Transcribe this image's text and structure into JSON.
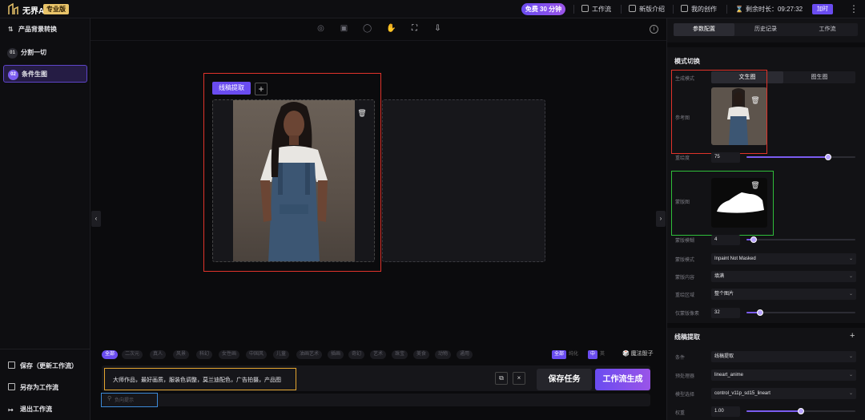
{
  "topbar": {
    "logo_text": "无界AI",
    "edition": "专业版",
    "free_pill": "免费 30 分钟",
    "nav": [
      "工作流",
      "新版介绍",
      "我的创作"
    ],
    "remaining_label": "剩余时长：09:27:32",
    "pay_label": "加时"
  },
  "sidebar": {
    "title": "产品背景转换",
    "items": [
      {
        "num": "01",
        "label": "分割一切"
      },
      {
        "num": "02",
        "label": "条件生图"
      }
    ],
    "bottom": [
      "保存（更新工作流）",
      "另存为工作流",
      "退出工作流"
    ]
  },
  "canvas": {
    "tab_label": "线稿提取",
    "add_label": "+"
  },
  "prompt": {
    "tags": [
      "全部",
      "二次元",
      "真人",
      "风景",
      "科幻",
      "女性画",
      "中国风",
      "儿童",
      "油画艺术",
      "插画",
      "奇幻",
      "艺术",
      "珠宝",
      "美食",
      "动物",
      "通用"
    ],
    "toggle_all": "全部",
    "toggle_pure": "纯化",
    "toggle_on": "中",
    "toggle_en": "英",
    "magic_label": "魔法骰子",
    "prompt_text": "大师作品，最好画质，服装色调整，莫兰迪配色，广告拍摄，产品图",
    "negative_placeholder": "负向提示",
    "copy_icon": "⧉",
    "clear_icon": "×",
    "save_task": "保存任务",
    "generate": "工作流生成"
  },
  "panel": {
    "tabs": [
      "参数配置",
      "历史记录",
      "工作流"
    ],
    "mode_section": "模式切换",
    "gen_mode_label": "生成模式",
    "gen_mode_options": [
      "文生图",
      "图生图"
    ],
    "ref_label": "参考图",
    "denoise_label": "重绘度",
    "denoise_value": 75,
    "denoise_range": [
      0,
      100
    ],
    "mask_label": "蒙版图",
    "mask_blur_label": "蒙版模糊",
    "mask_blur_value": 4,
    "mask_blur_range": [
      0,
      64
    ],
    "mask_mode_label": "蒙版模式",
    "mask_mode_value": "Inpaint Not Masked",
    "mask_content_label": "蒙版内容",
    "mask_content_value": "填满",
    "inpaint_area_label": "重绘区域",
    "inpaint_area_value": "整个图片",
    "only_mask_pad_label": "仅蒙版像素",
    "only_mask_pad_value": 32,
    "only_mask_pad_range": [
      0,
      256
    ],
    "lineart_section": "线稿提取",
    "condition_label": "条件",
    "condition_value": "线稿提取",
    "preprocess_label": "预处理器",
    "preprocess_value": "lineart_anime",
    "model_label": "模型选择",
    "model_value": "control_v11p_sd15_lineart",
    "weight_label": "权重",
    "weight_value": "1.00",
    "weight_fraction": 0.5
  },
  "colors": {
    "accent": "#6a4cf0",
    "highlight_red": "#e0332a",
    "highlight_green": "#2fbe3a",
    "highlight_yellow": "#e5a630",
    "highlight_blue": "#3c8ad8"
  }
}
